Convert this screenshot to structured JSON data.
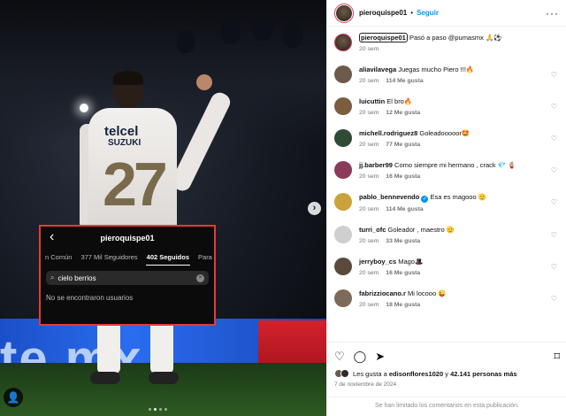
{
  "post": {
    "author": "pieroquispe01",
    "follow_label": "Seguir",
    "separator": "•",
    "more_icon": "ellipsis-icon"
  },
  "photo": {
    "overlay": {
      "back_icon": "chevron-left-icon",
      "title": "pieroquispe01",
      "tabs": [
        "n Común",
        "377 Mil Seguidores",
        "402 Seguidos",
        "Para ti"
      ],
      "active_tab": 2,
      "search_value": "cielo berrios",
      "empty_message": "No se encontraron usuarios"
    },
    "next_icon": "›",
    "carousel_dots": 4,
    "active_dot": 1
  },
  "caption": {
    "user": "pieroquispe01",
    "text": "Pasó a paso @pumasmx 🙏⚽",
    "time": "20 sem"
  },
  "comments": [
    {
      "user": "aliavilavega",
      "text": "Juegas mucho Piero !!!🔥",
      "time": "20 sem",
      "likes": "114 Me gusta",
      "reply": "Responder",
      "avatar_color": "#6d5a4a"
    },
    {
      "user": "luicuttin",
      "text": "El bro🔥",
      "time": "20 sem",
      "likes": "12 Me gusta",
      "reply": "Responder",
      "avatar_color": "#7a5e3f"
    },
    {
      "user": "michell.rodriguez8",
      "text": "Goleadooooor🤩",
      "time": "20 sem",
      "likes": "77 Me gusta",
      "reply": "Responder",
      "avatar_color": "#2f4a35"
    },
    {
      "user": "jj.barber99",
      "text": "Como siempre mi hermano , crack 💎 🧯",
      "time": "20 sem",
      "likes": "16 Me gusta",
      "reply": "Responder",
      "avatar_color": "#8a3b5a"
    },
    {
      "user": "pablo_bennevendo",
      "text": "Esa es magooo 🫡",
      "time": "20 sem",
      "likes": "114 Me gusta",
      "reply": "Responder",
      "verified": true,
      "avatar_color": "#c9a23a"
    },
    {
      "user": "turri_ofc",
      "text": "Goleador , maestro 🫡",
      "time": "20 sem",
      "likes": "33 Me gusta",
      "reply": "Responder",
      "avatar_color": "#cfcfcf"
    },
    {
      "user": "jerryboy_cs",
      "text": "Mago🎩",
      "time": "20 sem",
      "likes": "16 Me gusta",
      "reply": "Responder",
      "avatar_color": "#5b4a3c"
    },
    {
      "user": "fabrizziocano.r",
      "text": "Mi locooo 😜",
      "time": "20 sem",
      "likes": "18 Me gusta",
      "reply": "Responder",
      "avatar_color": "#7d6a58"
    }
  ],
  "actions": {
    "like_icon": "heart-icon",
    "comment_icon": "comment-icon",
    "share_icon": "share-icon",
    "save_icon": "bookmark-icon",
    "likes_prefix": "Les gusta a",
    "likes_user": "edisonflores1020",
    "likes_mid": "y",
    "likes_count": "42.141 personas más",
    "date": "7 de noviembre de 2024",
    "comments_limited": "Se han limitado los comentarios en esta publicación."
  }
}
